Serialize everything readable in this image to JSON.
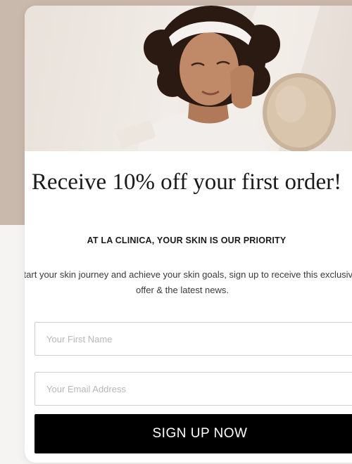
{
  "popup": {
    "headline": "Receive 10% off your first order!",
    "subheadline": "AT LA CLINICA, YOUR SKIN IS OUR PRIORITY",
    "body": "To start your skin journey and achieve your skin goals, sign up to receive this exclusive offer & the latest news.",
    "first_name_placeholder": "Your First Name",
    "email_placeholder": "Your Email Address",
    "submit_label": "SIGN UP NOW"
  },
  "colors": {
    "backdrop_accent": "#c9b8ac",
    "button_background": "#000000",
    "button_text": "#ffffff",
    "input_border": "#cfcfcf"
  },
  "hero_image": {
    "subject": "woman-applying-skincare-with-mirror"
  }
}
